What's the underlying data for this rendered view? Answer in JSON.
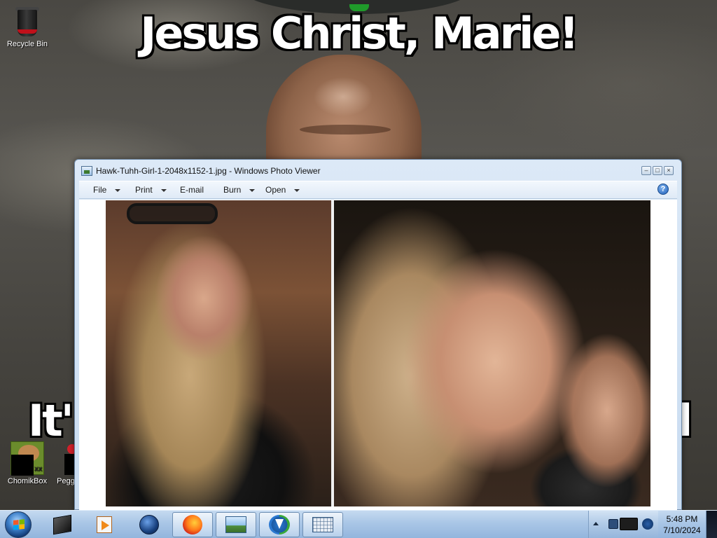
{
  "desktop": {
    "meme": {
      "top_text": "Jesus Christ,  Marie!",
      "bottom_left_fragment": "It'",
      "bottom_right_fragment": "l"
    },
    "icons": [
      {
        "label": "Recycle Bin",
        "icon": "recycle-bin-icon"
      },
      {
        "label": "ChomikBox",
        "icon": "chomikbox-icon"
      },
      {
        "label": "Pegg",
        "icon": "pegg-app-icon"
      }
    ]
  },
  "photo_viewer": {
    "title": "Hawk-Tuhh-Girl-1-2048x1152-1.jpg - Windows Photo Viewer",
    "menu": {
      "file": "File",
      "print": "Print",
      "email": "E-mail",
      "burn": "Burn",
      "open": "Open"
    },
    "help_glyph": "?",
    "window_controls": {
      "minimize": "–",
      "maximize": "□",
      "close": "×"
    }
  },
  "taskbar": {
    "pinned": [
      {
        "name": "3d-cube-app-icon",
        "active": false
      },
      {
        "name": "media-player-icon",
        "active": false
      },
      {
        "name": "globe-app-icon",
        "active": false
      },
      {
        "name": "firefox-icon",
        "active": true
      },
      {
        "name": "photo-viewer-icon",
        "active": true
      },
      {
        "name": "internet-download-manager-icon",
        "active": true
      },
      {
        "name": "on-screen-keyboard-icon",
        "active": true
      }
    ],
    "clock": {
      "time": "5:48 PM",
      "date": "7/10/2024"
    }
  },
  "colors": {
    "taskbar": "#a9c6e6",
    "window_chrome": "#dce9f7",
    "viewer_background": "#ffffff"
  }
}
